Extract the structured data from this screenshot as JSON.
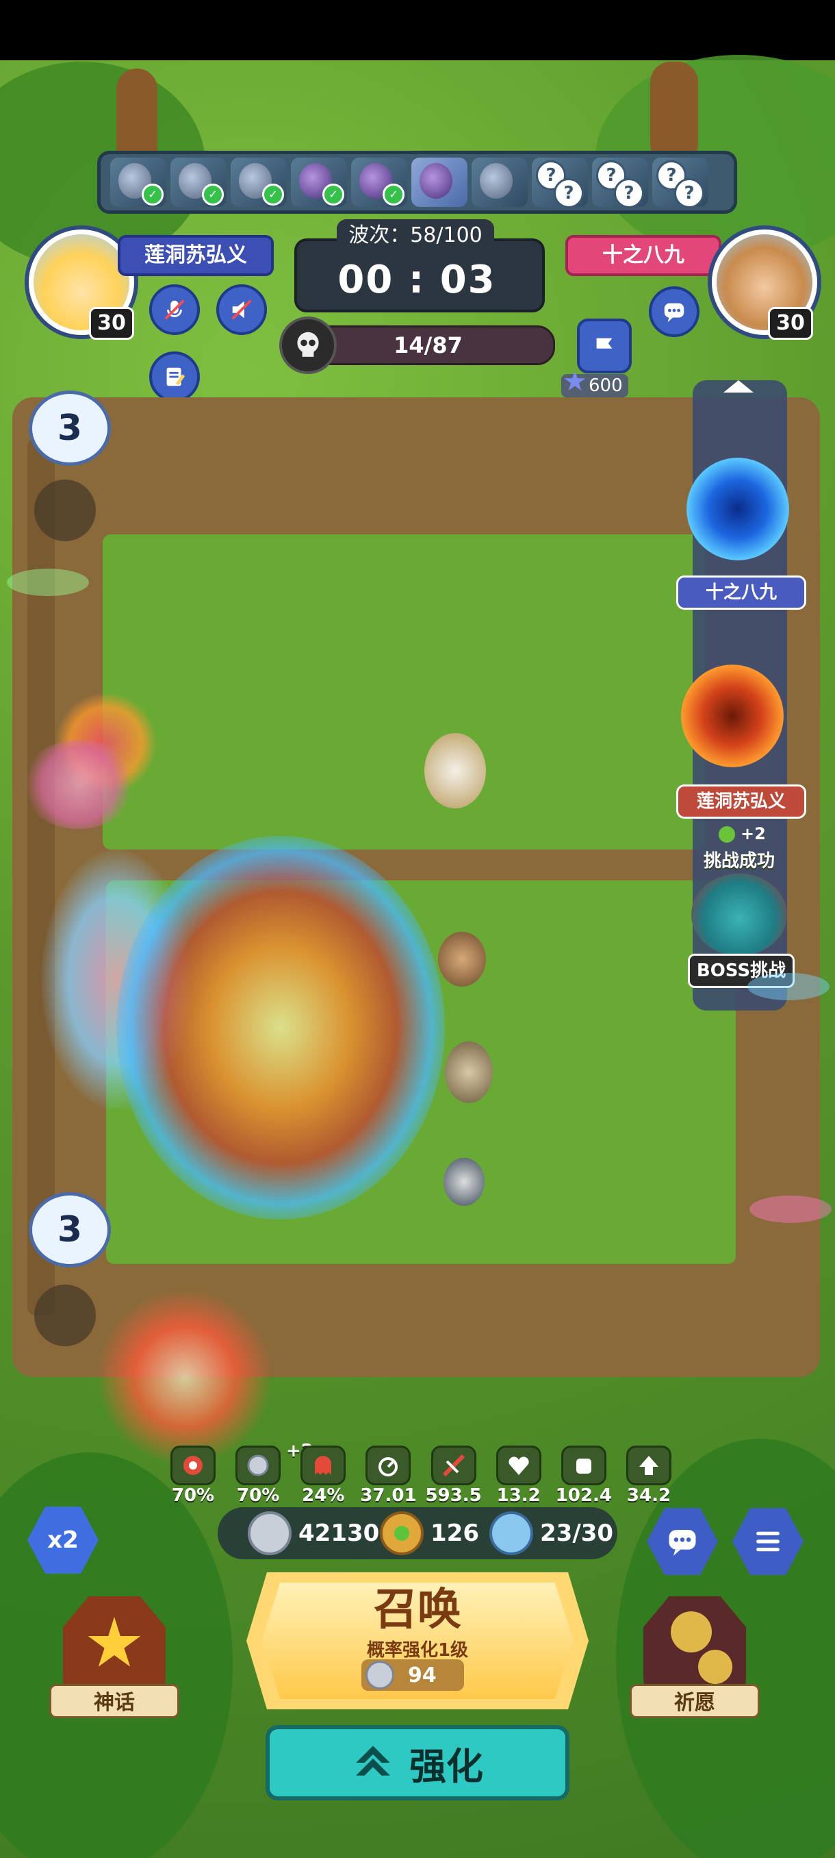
{
  "players": {
    "left": {
      "name": "莲洞苏弘义",
      "level": "30"
    },
    "right": {
      "name": "十之八九",
      "level": "30"
    }
  },
  "wave": {
    "label": "波次：58/100"
  },
  "timer": {
    "value": "00 : 03"
  },
  "kills": {
    "value": "14/87"
  },
  "stars": {
    "value": "600"
  },
  "spawn": {
    "opponent_tag": "十之八九",
    "self_tag": "莲洞苏弘义",
    "reward": "+2",
    "challenge_result": "挑战成功",
    "boss_label": "BOSS挑战"
  },
  "bubbles": {
    "top": "3",
    "bottom": "3"
  },
  "stats": [
    {
      "icon": "crit-rate-icon",
      "value": "70%"
    },
    {
      "icon": "silver-coin-icon",
      "value": "70%"
    },
    {
      "icon": "ghost-icon",
      "value": "24%"
    },
    {
      "icon": "speed-icon",
      "value": "37.01"
    },
    {
      "icon": "slash-icon",
      "value": "593.5"
    },
    {
      "icon": "heart-break-icon",
      "value": "13.2"
    },
    {
      "icon": "fist-icon",
      "value": "102.4"
    },
    {
      "icon": "arrow-up-icon",
      "value": "34.2"
    }
  ],
  "stat_bonus": "+2",
  "resources": {
    "silver": "42130",
    "clover": "126",
    "units": "23/30"
  },
  "buttons": {
    "speed": "x2",
    "summon_title": "召唤",
    "summon_sub": "概率强化1级",
    "summon_cost": "94",
    "myth": "神话",
    "wish": "祈愿",
    "upgrade": "强化"
  },
  "colors": {
    "accent_blue": "#3c4fb5",
    "accent_pink": "#e3477a",
    "upgrade_teal": "#2ec9c2",
    "summon_gold": "#ffd872"
  }
}
